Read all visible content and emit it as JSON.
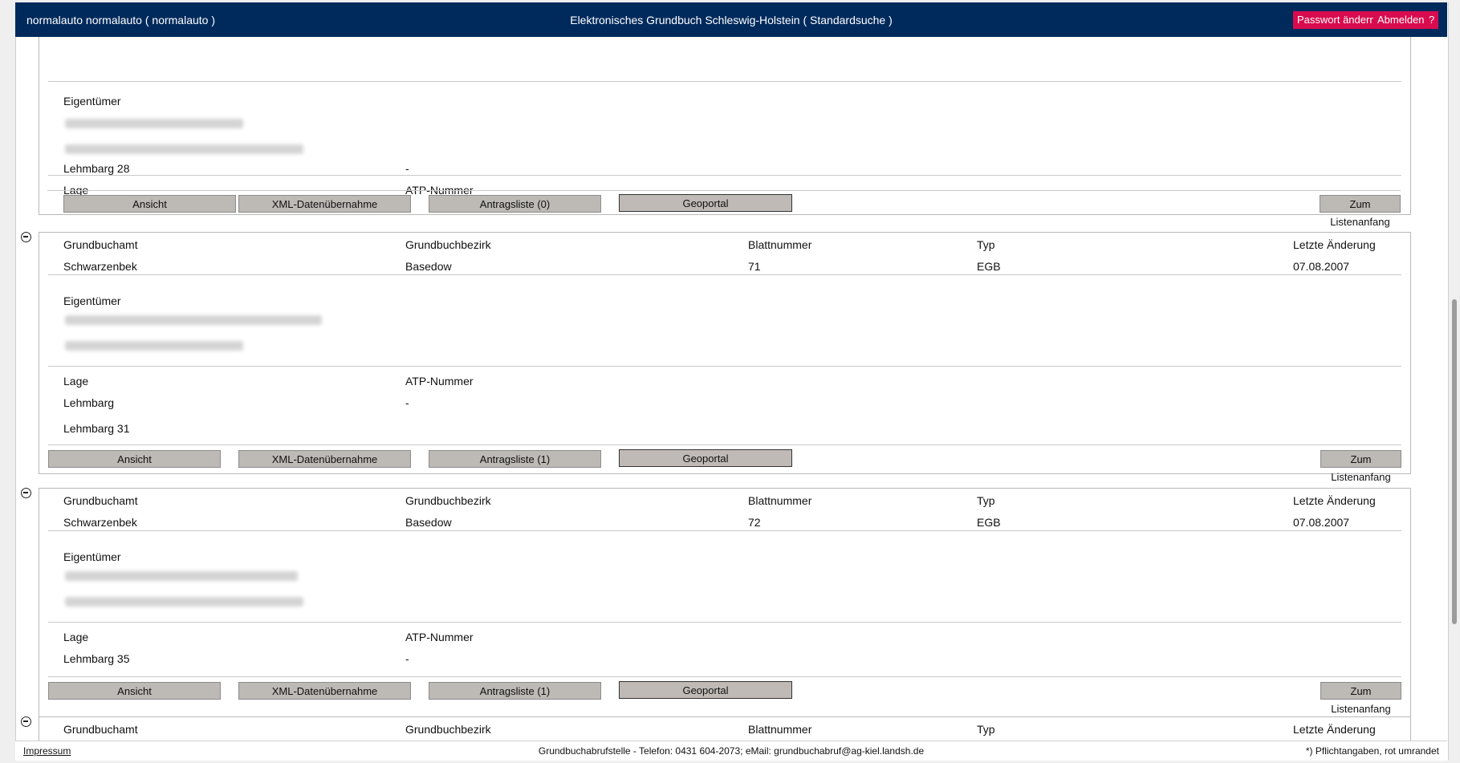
{
  "header": {
    "user": "normalauto normalauto  ( normalauto )",
    "title": "Elektronisches Grundbuch Schleswig-Holstein  ( Standardsuche )",
    "password_button": "Passwort ändern",
    "logout_button": "Abmelden",
    "help_button": "?"
  },
  "labels": {
    "grundbuchamt": "Grundbuchamt",
    "grundbuchbezirk": "Grundbuchbezirk",
    "blattnummer": "Blattnummer",
    "typ": "Typ",
    "letzte_aenderung": "Letzte Änderung",
    "eigentuemer": "Eigentümer",
    "lage": "Lage",
    "atp": "ATP-Nummer"
  },
  "buttons": {
    "ansicht": "Ansicht",
    "xml": "XML-Datenübernahme",
    "geoportal": "Geoportal",
    "listenanfang": "Zum Listenanfang"
  },
  "records": [
    {
      "lage": [
        "Lehmbarg 28"
      ],
      "atp": "-",
      "antragsliste": "Antragsliste (0)"
    },
    {
      "grundbuchamt": "Schwarzenbek",
      "grundbuchbezirk": "Basedow",
      "blattnummer": "71",
      "typ": "EGB",
      "letzte_aenderung": "07.08.2007",
      "lage": [
        "Lehmbarg",
        "Lehmbarg 31"
      ],
      "atp": "-",
      "antragsliste": "Antragsliste (1)"
    },
    {
      "grundbuchamt": "Schwarzenbek",
      "grundbuchbezirk": "Basedow",
      "blattnummer": "72",
      "typ": "EGB",
      "letzte_aenderung": "07.08.2007",
      "lage": [
        "Lehmbarg 35"
      ],
      "atp": "-",
      "antragsliste": "Antragsliste (1)"
    }
  ],
  "footer": {
    "impressum": "Impressum",
    "contact": "Grundbuchabrufstelle - Telefon: 0431 604-2073; eMail: grundbuchabruf@ag-kiel.landsh.de",
    "note": "*) Pflichtangaben, rot umrandet"
  }
}
